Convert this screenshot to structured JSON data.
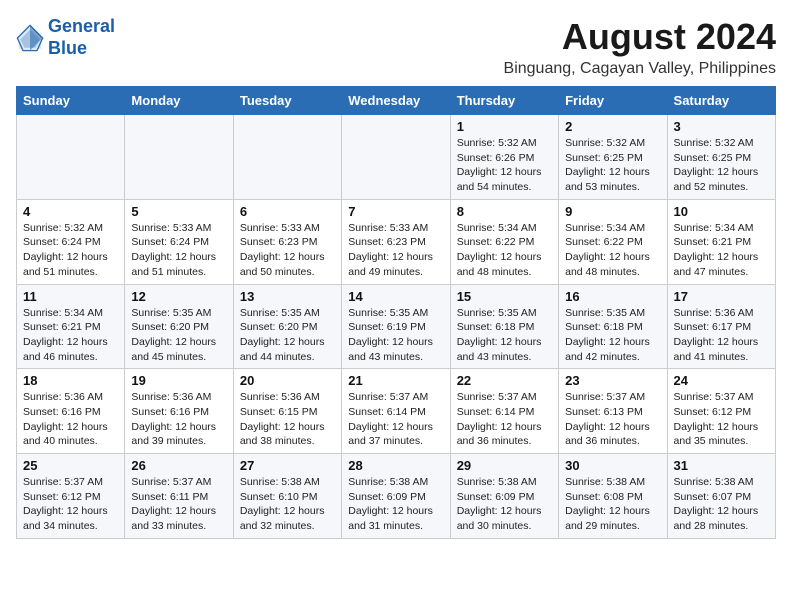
{
  "logo": {
    "line1": "General",
    "line2": "Blue"
  },
  "title": "August 2024",
  "subtitle": "Binguang, Cagayan Valley, Philippines",
  "days_of_week": [
    "Sunday",
    "Monday",
    "Tuesday",
    "Wednesday",
    "Thursday",
    "Friday",
    "Saturday"
  ],
  "weeks": [
    [
      {
        "day": "",
        "info": ""
      },
      {
        "day": "",
        "info": ""
      },
      {
        "day": "",
        "info": ""
      },
      {
        "day": "",
        "info": ""
      },
      {
        "day": "1",
        "info": "Sunrise: 5:32 AM\nSunset: 6:26 PM\nDaylight: 12 hours\nand 54 minutes."
      },
      {
        "day": "2",
        "info": "Sunrise: 5:32 AM\nSunset: 6:25 PM\nDaylight: 12 hours\nand 53 minutes."
      },
      {
        "day": "3",
        "info": "Sunrise: 5:32 AM\nSunset: 6:25 PM\nDaylight: 12 hours\nand 52 minutes."
      }
    ],
    [
      {
        "day": "4",
        "info": "Sunrise: 5:32 AM\nSunset: 6:24 PM\nDaylight: 12 hours\nand 51 minutes."
      },
      {
        "day": "5",
        "info": "Sunrise: 5:33 AM\nSunset: 6:24 PM\nDaylight: 12 hours\nand 51 minutes."
      },
      {
        "day": "6",
        "info": "Sunrise: 5:33 AM\nSunset: 6:23 PM\nDaylight: 12 hours\nand 50 minutes."
      },
      {
        "day": "7",
        "info": "Sunrise: 5:33 AM\nSunset: 6:23 PM\nDaylight: 12 hours\nand 49 minutes."
      },
      {
        "day": "8",
        "info": "Sunrise: 5:34 AM\nSunset: 6:22 PM\nDaylight: 12 hours\nand 48 minutes."
      },
      {
        "day": "9",
        "info": "Sunrise: 5:34 AM\nSunset: 6:22 PM\nDaylight: 12 hours\nand 48 minutes."
      },
      {
        "day": "10",
        "info": "Sunrise: 5:34 AM\nSunset: 6:21 PM\nDaylight: 12 hours\nand 47 minutes."
      }
    ],
    [
      {
        "day": "11",
        "info": "Sunrise: 5:34 AM\nSunset: 6:21 PM\nDaylight: 12 hours\nand 46 minutes."
      },
      {
        "day": "12",
        "info": "Sunrise: 5:35 AM\nSunset: 6:20 PM\nDaylight: 12 hours\nand 45 minutes."
      },
      {
        "day": "13",
        "info": "Sunrise: 5:35 AM\nSunset: 6:20 PM\nDaylight: 12 hours\nand 44 minutes."
      },
      {
        "day": "14",
        "info": "Sunrise: 5:35 AM\nSunset: 6:19 PM\nDaylight: 12 hours\nand 43 minutes."
      },
      {
        "day": "15",
        "info": "Sunrise: 5:35 AM\nSunset: 6:18 PM\nDaylight: 12 hours\nand 43 minutes."
      },
      {
        "day": "16",
        "info": "Sunrise: 5:35 AM\nSunset: 6:18 PM\nDaylight: 12 hours\nand 42 minutes."
      },
      {
        "day": "17",
        "info": "Sunrise: 5:36 AM\nSunset: 6:17 PM\nDaylight: 12 hours\nand 41 minutes."
      }
    ],
    [
      {
        "day": "18",
        "info": "Sunrise: 5:36 AM\nSunset: 6:16 PM\nDaylight: 12 hours\nand 40 minutes."
      },
      {
        "day": "19",
        "info": "Sunrise: 5:36 AM\nSunset: 6:16 PM\nDaylight: 12 hours\nand 39 minutes."
      },
      {
        "day": "20",
        "info": "Sunrise: 5:36 AM\nSunset: 6:15 PM\nDaylight: 12 hours\nand 38 minutes."
      },
      {
        "day": "21",
        "info": "Sunrise: 5:37 AM\nSunset: 6:14 PM\nDaylight: 12 hours\nand 37 minutes."
      },
      {
        "day": "22",
        "info": "Sunrise: 5:37 AM\nSunset: 6:14 PM\nDaylight: 12 hours\nand 36 minutes."
      },
      {
        "day": "23",
        "info": "Sunrise: 5:37 AM\nSunset: 6:13 PM\nDaylight: 12 hours\nand 36 minutes."
      },
      {
        "day": "24",
        "info": "Sunrise: 5:37 AM\nSunset: 6:12 PM\nDaylight: 12 hours\nand 35 minutes."
      }
    ],
    [
      {
        "day": "25",
        "info": "Sunrise: 5:37 AM\nSunset: 6:12 PM\nDaylight: 12 hours\nand 34 minutes."
      },
      {
        "day": "26",
        "info": "Sunrise: 5:37 AM\nSunset: 6:11 PM\nDaylight: 12 hours\nand 33 minutes."
      },
      {
        "day": "27",
        "info": "Sunrise: 5:38 AM\nSunset: 6:10 PM\nDaylight: 12 hours\nand 32 minutes."
      },
      {
        "day": "28",
        "info": "Sunrise: 5:38 AM\nSunset: 6:09 PM\nDaylight: 12 hours\nand 31 minutes."
      },
      {
        "day": "29",
        "info": "Sunrise: 5:38 AM\nSunset: 6:09 PM\nDaylight: 12 hours\nand 30 minutes."
      },
      {
        "day": "30",
        "info": "Sunrise: 5:38 AM\nSunset: 6:08 PM\nDaylight: 12 hours\nand 29 minutes."
      },
      {
        "day": "31",
        "info": "Sunrise: 5:38 AM\nSunset: 6:07 PM\nDaylight: 12 hours\nand 28 minutes."
      }
    ]
  ]
}
